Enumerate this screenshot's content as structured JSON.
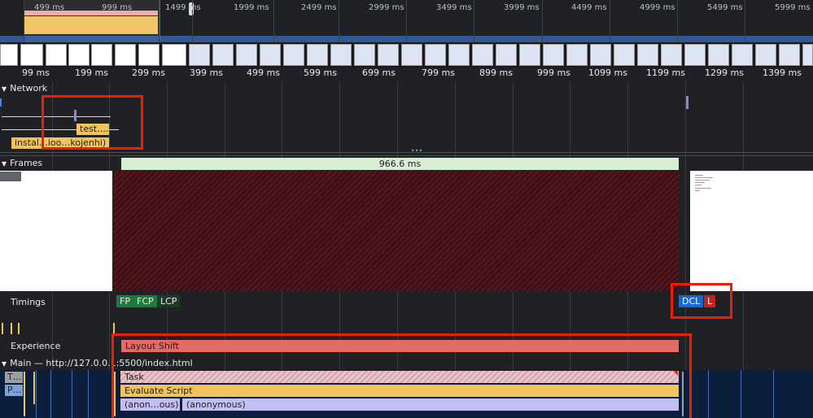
{
  "overview": {
    "labels": [
      "499 ms",
      "999 ms",
      "1499 ms",
      "1999 ms",
      "2499 ms",
      "2999 ms",
      "3499 ms",
      "3999 ms",
      "4499 ms",
      "4999 ms",
      "5499 ms",
      "5999 ms"
    ]
  },
  "ruler": {
    "ticks": [
      "99 ms",
      "199 ms",
      "299 ms",
      "399 ms",
      "499 ms",
      "599 ms",
      "699 ms",
      "799 ms",
      "899 ms",
      "999 ms",
      "1099 ms",
      "1199 ms",
      "1299 ms",
      "1399 ms"
    ]
  },
  "network": {
    "title": "Network",
    "requests": [
      {
        "label": "test.…"
      },
      {
        "label": "instal…ioo…kojenhi)"
      }
    ]
  },
  "frames": {
    "title": "Frames",
    "duration": "966.6 ms"
  },
  "timings": {
    "title": "Timings",
    "markers": [
      {
        "label": "FP",
        "color": "#1e7a3a"
      },
      {
        "label": "FCP",
        "color": "#1e7a3a"
      },
      {
        "label": "LCP",
        "color": "#1c3a24"
      },
      {
        "label": "DCL",
        "color": "#1967d2"
      },
      {
        "label": "L",
        "color": "#c5221f"
      }
    ]
  },
  "experience": {
    "title": "Experience",
    "layout_shift": "Layout Shift"
  },
  "main": {
    "title": "Main — http://127.0.0.1:5500/index.html",
    "side_task": "T…",
    "side_parse": "P…",
    "task": "Task",
    "evaluate": "Evaluate Script",
    "anon_short": "(anon…ous)",
    "anon": "(anonymous)"
  },
  "colors": {
    "highlight": "#f21d00",
    "frame_bar": "#d7eed5",
    "task": "#f0c35b",
    "layout_shift": "#e56a64",
    "js": "#c3bff2"
  }
}
